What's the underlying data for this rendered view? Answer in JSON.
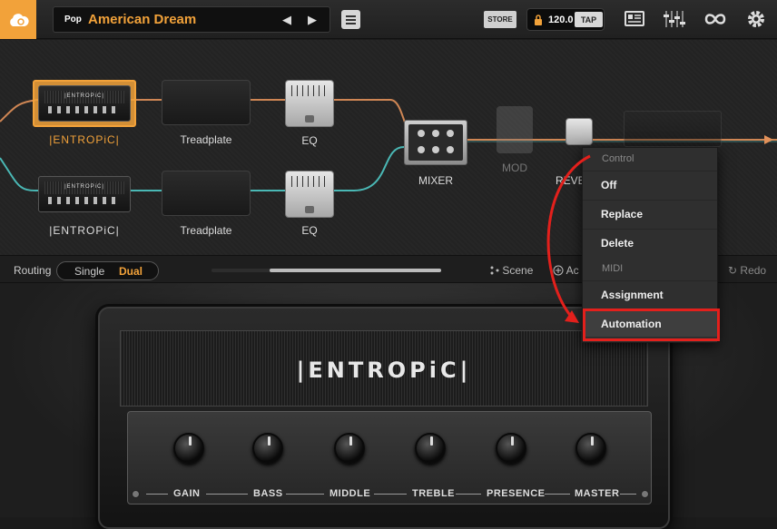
{
  "topbar": {
    "logo_icon": "cloud-logo-icon",
    "preset_category": "Pop",
    "preset_name": "American Dream",
    "prev_icon": "◀",
    "next_icon": "▶",
    "store_label": "STORE",
    "tempo": "120.0",
    "tap_label": "TAP",
    "accent_color": "#f2a23a"
  },
  "chain": {
    "top_row": [
      {
        "label": "|ENTROPiC|",
        "type": "amp",
        "selected": true
      },
      {
        "label": "Treadplate",
        "type": "cabinet"
      },
      {
        "label": "EQ",
        "type": "pedal"
      }
    ],
    "bottom_row": [
      {
        "label": "|ENTROPiC|",
        "type": "amp"
      },
      {
        "label": "Treadplate",
        "type": "cabinet"
      },
      {
        "label": "EQ",
        "type": "pedal"
      }
    ],
    "mixer_label": "MIXER",
    "mod_label": "MOD",
    "reverb_label": "REVE",
    "mini_amp_brand": "|ENTROPiC|"
  },
  "routing": {
    "label": "Routing",
    "single": "Single",
    "dual": "Dual",
    "scene": "Scene",
    "add": "Ac",
    "redo": "Redo"
  },
  "amp": {
    "brand": "|ENTROPiC|",
    "knobs": [
      {
        "label": "GAIN"
      },
      {
        "label": "BASS"
      },
      {
        "label": "MIDDLE"
      },
      {
        "label": "TREBLE"
      },
      {
        "label": "PRESENCE"
      },
      {
        "label": "MASTER"
      }
    ]
  },
  "context_menu": {
    "control_header": "Control",
    "off": "Off",
    "replace": "Replace",
    "delete": "Delete",
    "midi_header": "MIDI",
    "assignment": "Assignment",
    "automation": "Automation",
    "highlight_color": "#e3201c"
  }
}
